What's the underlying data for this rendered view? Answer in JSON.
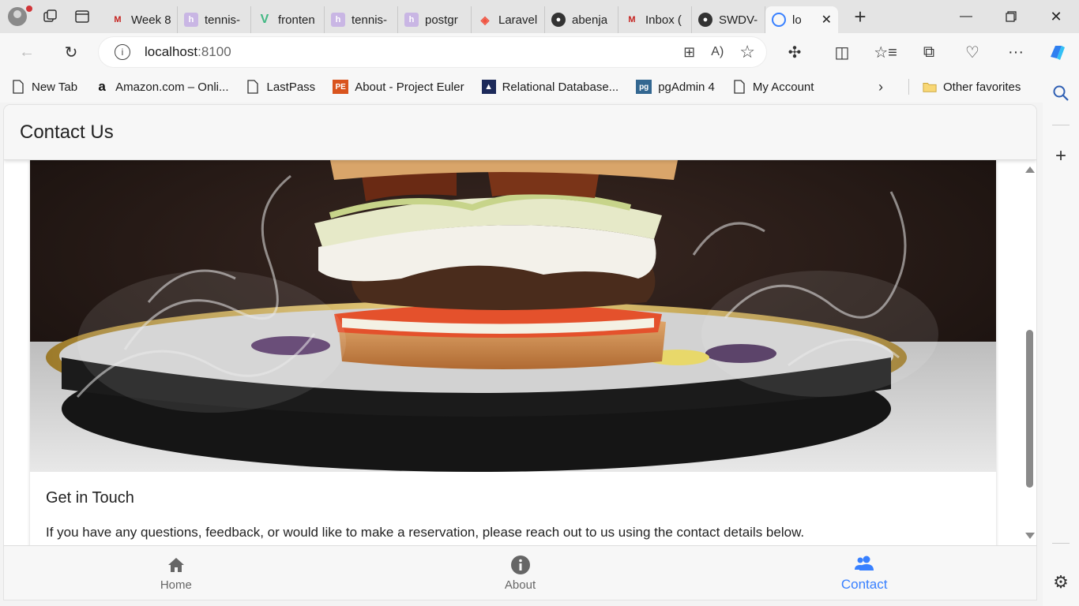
{
  "browser": {
    "tabs": [
      {
        "label": "Week 8",
        "icon": "gmail-icon"
      },
      {
        "label": "tennis-",
        "icon": "heroku-icon"
      },
      {
        "label": "fronten",
        "icon": "vue-icon"
      },
      {
        "label": "tennis-",
        "icon": "heroku-icon"
      },
      {
        "label": "postgr",
        "icon": "heroku-icon"
      },
      {
        "label": "Laravel",
        "icon": "laravel-icon"
      },
      {
        "label": "abenja",
        "icon": "github-icon"
      },
      {
        "label": "Inbox (",
        "icon": "gmail-icon"
      },
      {
        "label": "SWDV-",
        "icon": "github-icon"
      },
      {
        "label": "lo",
        "icon": "ionic-icon"
      }
    ],
    "address": {
      "host": "localhost",
      "port": ":8100"
    },
    "favorites": [
      {
        "label": "New Tab",
        "icon": "page-icon"
      },
      {
        "label": "Amazon.com – Onli...",
        "icon": "amazon-icon"
      },
      {
        "label": "LastPass",
        "icon": "page-icon"
      },
      {
        "label": "About - Project Euler",
        "icon": "project-euler-icon"
      },
      {
        "label": "Relational Database...",
        "icon": "database-icon"
      },
      {
        "label": "pgAdmin 4",
        "icon": "pgadmin-icon"
      },
      {
        "label": "My Account",
        "icon": "page-icon"
      }
    ],
    "other_favorites": "Other favorites"
  },
  "app": {
    "header_title": "Contact Us",
    "card": {
      "title": "Get in Touch",
      "text": "If you have any questions, feedback, or would like to make a reservation, please reach out to us using the contact details below."
    },
    "tabbar": [
      {
        "label": "Home",
        "icon": "home-icon",
        "selected": false
      },
      {
        "label": "About",
        "icon": "information-icon",
        "selected": false
      },
      {
        "label": "Contact",
        "icon": "people-icon",
        "selected": true
      }
    ]
  },
  "colors": {
    "accent": "#3880ff",
    "tab_inactive": "#666666"
  }
}
